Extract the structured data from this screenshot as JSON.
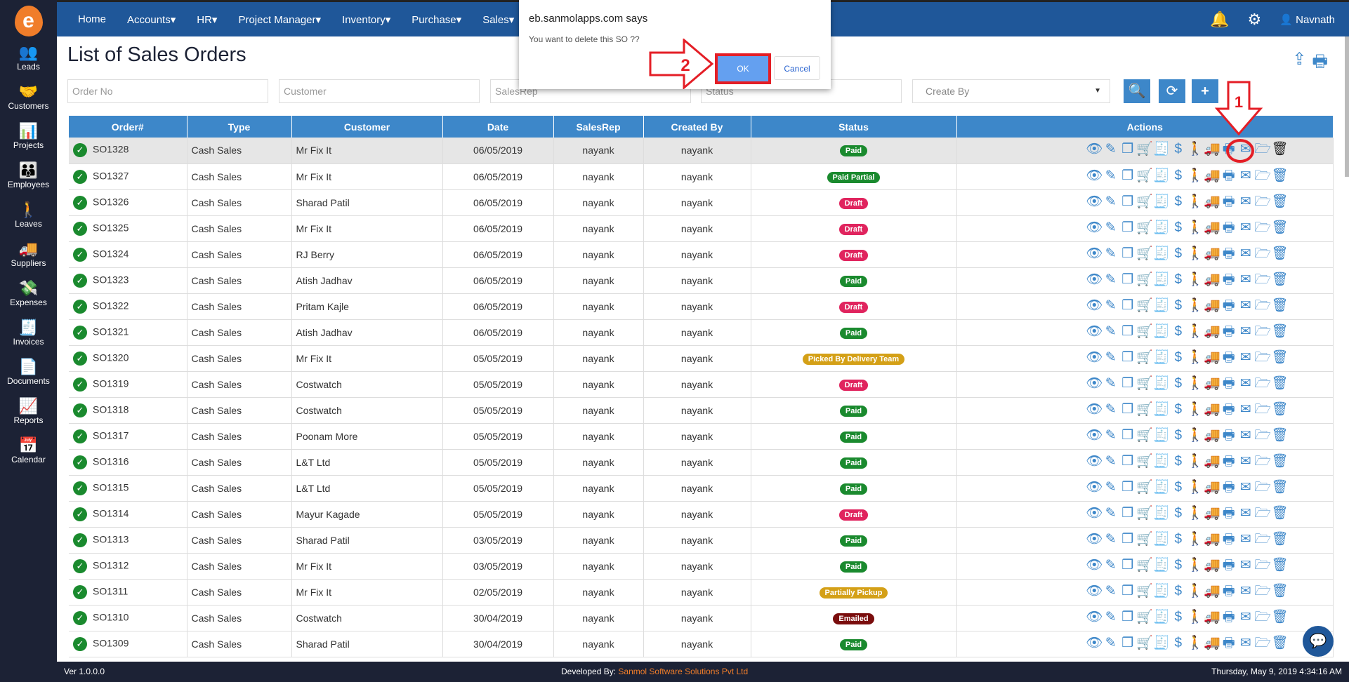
{
  "app": {
    "logo_text": "e"
  },
  "sidebar": {
    "items": [
      {
        "label": "Leads",
        "icon": "leads-icon"
      },
      {
        "label": "Customers",
        "icon": "customers-icon"
      },
      {
        "label": "Projects",
        "icon": "projects-icon"
      },
      {
        "label": "Employees",
        "icon": "employees-icon"
      },
      {
        "label": "Leaves",
        "icon": "leaves-icon"
      },
      {
        "label": "Suppliers",
        "icon": "suppliers-icon"
      },
      {
        "label": "Expenses",
        "icon": "expenses-icon"
      },
      {
        "label": "Invoices",
        "icon": "invoices-icon"
      },
      {
        "label": "Documents",
        "icon": "documents-icon"
      },
      {
        "label": "Reports",
        "icon": "reports-icon"
      },
      {
        "label": "Calendar",
        "icon": "calendar-icon"
      }
    ]
  },
  "nav": {
    "items": [
      "Home",
      "Accounts",
      "HR",
      "Project Manager",
      "Inventory",
      "Purchase",
      "Sales"
    ],
    "user": "Navnath"
  },
  "page": {
    "title": "List of Sales Orders"
  },
  "filters": {
    "order_no": "Order No",
    "customer": "Customer",
    "salesrep": "SalesRep",
    "status": "Status",
    "create_by": "Create By"
  },
  "dialog": {
    "title": "eb.sanmolapps.com says",
    "message": "You want to delete this SO ??",
    "ok": "OK",
    "cancel": "Cancel"
  },
  "annotations": {
    "step1": "1",
    "step2": "2"
  },
  "table": {
    "headers": [
      "Order#",
      "Type",
      "Customer",
      "Date",
      "SalesRep",
      "Created By",
      "Status",
      "Actions"
    ],
    "rows": [
      [
        "SO1328",
        "Cash Sales",
        "Mr Fix It",
        "06/05/2019",
        "nayank",
        "nayank",
        "Paid"
      ],
      [
        "SO1327",
        "Cash Sales",
        "Mr Fix It",
        "06/05/2019",
        "nayank",
        "nayank",
        "Paid Partial"
      ],
      [
        "SO1326",
        "Cash Sales",
        "Sharad Patil",
        "06/05/2019",
        "nayank",
        "nayank",
        "Draft"
      ],
      [
        "SO1325",
        "Cash Sales",
        "Mr Fix It",
        "06/05/2019",
        "nayank",
        "nayank",
        "Draft"
      ],
      [
        "SO1324",
        "Cash Sales",
        "RJ Berry",
        "06/05/2019",
        "nayank",
        "nayank",
        "Draft"
      ],
      [
        "SO1323",
        "Cash Sales",
        "Atish Jadhav",
        "06/05/2019",
        "nayank",
        "nayank",
        "Paid"
      ],
      [
        "SO1322",
        "Cash Sales",
        "Pritam Kajle",
        "06/05/2019",
        "nayank",
        "nayank",
        "Draft"
      ],
      [
        "SO1321",
        "Cash Sales",
        "Atish Jadhav",
        "06/05/2019",
        "nayank",
        "nayank",
        "Paid"
      ],
      [
        "SO1320",
        "Cash Sales",
        "Mr Fix It",
        "05/05/2019",
        "nayank",
        "nayank",
        "Picked By Delivery Team"
      ],
      [
        "SO1319",
        "Cash Sales",
        "Costwatch",
        "05/05/2019",
        "nayank",
        "nayank",
        "Draft"
      ],
      [
        "SO1318",
        "Cash Sales",
        "Costwatch",
        "05/05/2019",
        "nayank",
        "nayank",
        "Paid"
      ],
      [
        "SO1317",
        "Cash Sales",
        "Poonam More",
        "05/05/2019",
        "nayank",
        "nayank",
        "Paid"
      ],
      [
        "SO1316",
        "Cash Sales",
        "L&T Ltd",
        "05/05/2019",
        "nayank",
        "nayank",
        "Paid"
      ],
      [
        "SO1315",
        "Cash Sales",
        "L&T Ltd",
        "05/05/2019",
        "nayank",
        "nayank",
        "Paid"
      ],
      [
        "SO1314",
        "Cash Sales",
        "Mayur Kagade",
        "05/05/2019",
        "nayank",
        "nayank",
        "Draft"
      ],
      [
        "SO1313",
        "Cash Sales",
        "Sharad Patil",
        "03/05/2019",
        "nayank",
        "nayank",
        "Paid"
      ],
      [
        "SO1312",
        "Cash Sales",
        "Mr Fix It",
        "03/05/2019",
        "nayank",
        "nayank",
        "Paid"
      ],
      [
        "SO1311",
        "Cash Sales",
        "Mr Fix It",
        "02/05/2019",
        "nayank",
        "nayank",
        "Partially Pickup"
      ],
      [
        "SO1310",
        "Cash Sales",
        "Costwatch",
        "30/04/2019",
        "nayank",
        "nayank",
        "Emailed"
      ],
      [
        "SO1309",
        "Cash Sales",
        "Sharad Patil",
        "30/04/2019",
        "nayank",
        "nayank",
        "Paid"
      ]
    ]
  },
  "status_colors": {
    "Paid": "#1a8a2e",
    "Paid Partial": "#1a8a2e",
    "Draft": "#e0245e",
    "Picked By Delivery Team": "#d4a017",
    "Partially Pickup": "#d4a017",
    "Emailed": "#7a0d0d"
  },
  "actions": [
    "view",
    "edit",
    "copy",
    "cart",
    "invoice",
    "payment",
    "delivery",
    "truck",
    "print",
    "email",
    "folder",
    "delete"
  ],
  "footer": {
    "version": "Ver 1.0.0.0",
    "dev_label": "Developed By:",
    "dev_company": "Sanmol Software Solutions Pvt Ltd",
    "datetime": "Thursday, May 9, 2019 4:34:16 AM"
  }
}
